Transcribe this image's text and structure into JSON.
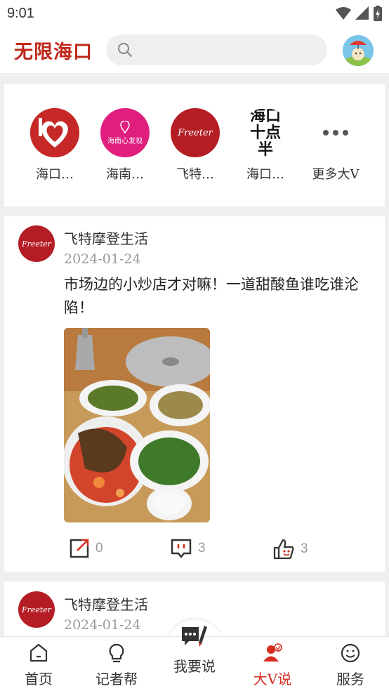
{
  "status_bar": {
    "time": "9:01"
  },
  "header": {
    "brand": "无限海口",
    "search_placeholder": ""
  },
  "vips": [
    {
      "name": "海口…"
    },
    {
      "name": "海南…",
      "logo_text": "海南心发现"
    },
    {
      "name": "飞特…",
      "logo_text": "Freeter"
    },
    {
      "name": "海口…",
      "logo_text": "海口十点半"
    },
    {
      "name": "更多大V"
    }
  ],
  "posts": [
    {
      "author": "飞特摩登生活",
      "avatar_text": "Freeter",
      "date": "2024-01-24",
      "text": "市场边的小炒店才对嘛！一道甜酸鱼谁吃谁沦陷！",
      "shares": "0",
      "comments": "3",
      "likes": "3"
    },
    {
      "author": "飞特摩登生活",
      "avatar_text": "Freeter",
      "date": "2024-01-24"
    }
  ],
  "tabs": [
    {
      "label": "首页"
    },
    {
      "label": "记者帮"
    },
    {
      "label": "我要说"
    },
    {
      "label": "大V说"
    },
    {
      "label": "服务"
    }
  ],
  "colors": {
    "brand": "#c0281b",
    "active_tab": "#d62c20",
    "icon_red": "#d62c20"
  }
}
